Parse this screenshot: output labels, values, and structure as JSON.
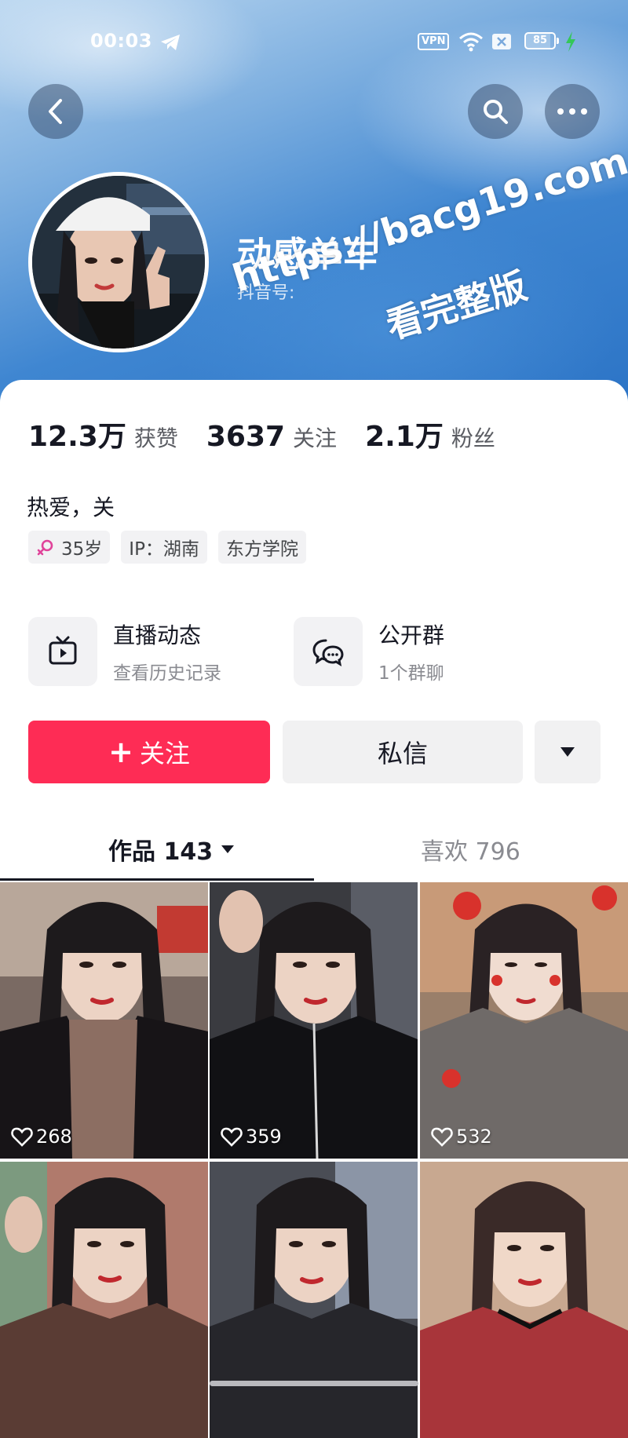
{
  "status_bar": {
    "time": "00:03",
    "vpn": "VPN",
    "battery": "85",
    "battery_level": 0.85
  },
  "profile": {
    "nickname": "动感单车",
    "douyin_id_label": "抖音号:",
    "bio": "热爱，关"
  },
  "watermark": {
    "line1": "https://bacg19.com",
    "line2": "看完整版"
  },
  "stats": [
    {
      "value": "12.3万",
      "label": "获赞"
    },
    {
      "value": "3637",
      "label": "关注"
    },
    {
      "value": "2.1万",
      "label": "粉丝"
    }
  ],
  "tags": {
    "age": "35岁",
    "ip": "IP：湖南",
    "school": "东方学院"
  },
  "features": {
    "live": {
      "title": "直播动态",
      "subtitle": "查看历史记录"
    },
    "group": {
      "title": "公开群",
      "subtitle": "1个群聊"
    }
  },
  "actions": {
    "follow_plus": "+",
    "follow": "关注",
    "message": "私信"
  },
  "tabs": {
    "works": "作品 143",
    "likes": "喜欢 796"
  },
  "videos": [
    {
      "likes": "268"
    },
    {
      "likes": "359"
    },
    {
      "likes": "532"
    },
    {
      "likes": ""
    },
    {
      "likes": ""
    },
    {
      "likes": ""
    }
  ],
  "colors": {
    "follow_button": "#fe2c55",
    "header_blue": "#3f86d1",
    "female_pink": "#e0439a"
  }
}
